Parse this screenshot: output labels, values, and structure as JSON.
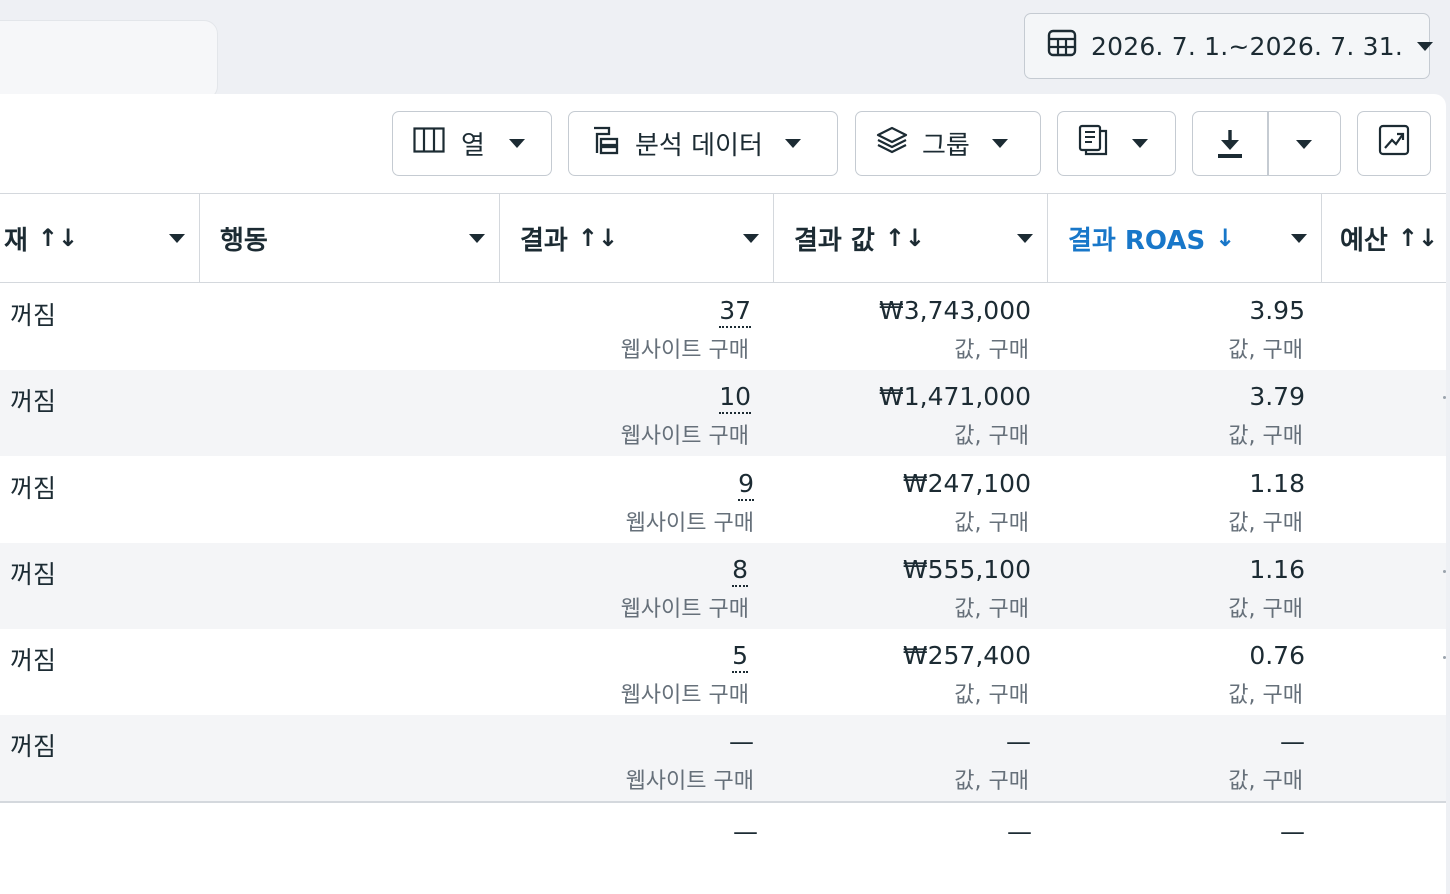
{
  "date_range": {
    "label": "2026. 7. 1.~2026. 7. 31.",
    "icon": "calendar-icon"
  },
  "toolbar": {
    "columns_label": "열",
    "breakdown_label": "분석 데이터",
    "group_label": "그룹",
    "reports_icon": "reports-icon",
    "export_icon": "download-icon",
    "chart_icon": "chart-trend-icon"
  },
  "columns": [
    {
      "key": "status",
      "label": "재",
      "sort": "↑↓"
    },
    {
      "key": "action",
      "label": "행동",
      "sort": ""
    },
    {
      "key": "results",
      "label": "결과",
      "sort": "↑↓"
    },
    {
      "key": "result_value",
      "label": "결과 값",
      "sort": "↑↓"
    },
    {
      "key": "roas",
      "label": "결과 ROAS",
      "sort": "↓"
    },
    {
      "key": "budget",
      "label": "예산",
      "sort": "↑↓"
    }
  ],
  "rows": [
    {
      "status": "꺼짐",
      "results": "37",
      "results_sub": "웹사이트 구매",
      "value": "₩3,743,000",
      "value_sub": "값, 구매",
      "roas": "3.95",
      "roas_sub": "값, 구매"
    },
    {
      "status": "꺼짐",
      "results": "10",
      "results_sub": "웹사이트 구매",
      "value": "₩1,471,000",
      "value_sub": "값, 구매",
      "roas": "3.79",
      "roas_sub": "값, 구매"
    },
    {
      "status": "꺼짐",
      "results": "9",
      "results_sub": "웹사이트 구매",
      "value": "₩247,100",
      "value_sub": "값, 구매",
      "roas": "1.18",
      "roas_sub": "값, 구매"
    },
    {
      "status": "꺼짐",
      "results": "8",
      "results_sub": "웹사이트 구매",
      "value": "₩555,100",
      "value_sub": "값, 구매",
      "roas": "1.16",
      "roas_sub": "값, 구매"
    },
    {
      "status": "꺼짐",
      "results": "5",
      "results_sub": "웹사이트 구매",
      "value": "₩257,400",
      "value_sub": "값, 구매",
      "roas": "0.76",
      "roas_sub": "값, 구매"
    },
    {
      "status": "꺼짐",
      "results": "—",
      "results_sub": "웹사이트 구매",
      "value": "—",
      "value_sub": "값, 구매",
      "roas": "—",
      "roas_sub": "값, 구매"
    }
  ],
  "totals": {
    "results": "—",
    "value": "—",
    "roas": "—"
  },
  "colors": {
    "accent": "#1877c9",
    "text": "#1c2b33",
    "subtext": "#66707a",
    "border": "#d4d8dd",
    "alt_row": "#f4f5f7"
  }
}
